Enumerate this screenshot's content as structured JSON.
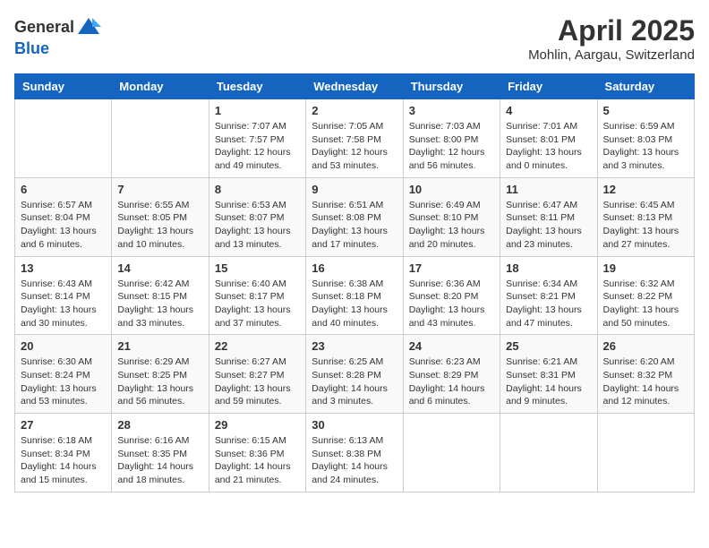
{
  "header": {
    "logo_general": "General",
    "logo_blue": "Blue",
    "month": "April 2025",
    "location": "Mohlin, Aargau, Switzerland"
  },
  "columns": [
    "Sunday",
    "Monday",
    "Tuesday",
    "Wednesday",
    "Thursday",
    "Friday",
    "Saturday"
  ],
  "weeks": [
    [
      {
        "day": "",
        "info": ""
      },
      {
        "day": "",
        "info": ""
      },
      {
        "day": "1",
        "info": "Sunrise: 7:07 AM\nSunset: 7:57 PM\nDaylight: 12 hours and 49 minutes."
      },
      {
        "day": "2",
        "info": "Sunrise: 7:05 AM\nSunset: 7:58 PM\nDaylight: 12 hours and 53 minutes."
      },
      {
        "day": "3",
        "info": "Sunrise: 7:03 AM\nSunset: 8:00 PM\nDaylight: 12 hours and 56 minutes."
      },
      {
        "day": "4",
        "info": "Sunrise: 7:01 AM\nSunset: 8:01 PM\nDaylight: 13 hours and 0 minutes."
      },
      {
        "day": "5",
        "info": "Sunrise: 6:59 AM\nSunset: 8:03 PM\nDaylight: 13 hours and 3 minutes."
      }
    ],
    [
      {
        "day": "6",
        "info": "Sunrise: 6:57 AM\nSunset: 8:04 PM\nDaylight: 13 hours and 6 minutes."
      },
      {
        "day": "7",
        "info": "Sunrise: 6:55 AM\nSunset: 8:05 PM\nDaylight: 13 hours and 10 minutes."
      },
      {
        "day": "8",
        "info": "Sunrise: 6:53 AM\nSunset: 8:07 PM\nDaylight: 13 hours and 13 minutes."
      },
      {
        "day": "9",
        "info": "Sunrise: 6:51 AM\nSunset: 8:08 PM\nDaylight: 13 hours and 17 minutes."
      },
      {
        "day": "10",
        "info": "Sunrise: 6:49 AM\nSunset: 8:10 PM\nDaylight: 13 hours and 20 minutes."
      },
      {
        "day": "11",
        "info": "Sunrise: 6:47 AM\nSunset: 8:11 PM\nDaylight: 13 hours and 23 minutes."
      },
      {
        "day": "12",
        "info": "Sunrise: 6:45 AM\nSunset: 8:13 PM\nDaylight: 13 hours and 27 minutes."
      }
    ],
    [
      {
        "day": "13",
        "info": "Sunrise: 6:43 AM\nSunset: 8:14 PM\nDaylight: 13 hours and 30 minutes."
      },
      {
        "day": "14",
        "info": "Sunrise: 6:42 AM\nSunset: 8:15 PM\nDaylight: 13 hours and 33 minutes."
      },
      {
        "day": "15",
        "info": "Sunrise: 6:40 AM\nSunset: 8:17 PM\nDaylight: 13 hours and 37 minutes."
      },
      {
        "day": "16",
        "info": "Sunrise: 6:38 AM\nSunset: 8:18 PM\nDaylight: 13 hours and 40 minutes."
      },
      {
        "day": "17",
        "info": "Sunrise: 6:36 AM\nSunset: 8:20 PM\nDaylight: 13 hours and 43 minutes."
      },
      {
        "day": "18",
        "info": "Sunrise: 6:34 AM\nSunset: 8:21 PM\nDaylight: 13 hours and 47 minutes."
      },
      {
        "day": "19",
        "info": "Sunrise: 6:32 AM\nSunset: 8:22 PM\nDaylight: 13 hours and 50 minutes."
      }
    ],
    [
      {
        "day": "20",
        "info": "Sunrise: 6:30 AM\nSunset: 8:24 PM\nDaylight: 13 hours and 53 minutes."
      },
      {
        "day": "21",
        "info": "Sunrise: 6:29 AM\nSunset: 8:25 PM\nDaylight: 13 hours and 56 minutes."
      },
      {
        "day": "22",
        "info": "Sunrise: 6:27 AM\nSunset: 8:27 PM\nDaylight: 13 hours and 59 minutes."
      },
      {
        "day": "23",
        "info": "Sunrise: 6:25 AM\nSunset: 8:28 PM\nDaylight: 14 hours and 3 minutes."
      },
      {
        "day": "24",
        "info": "Sunrise: 6:23 AM\nSunset: 8:29 PM\nDaylight: 14 hours and 6 minutes."
      },
      {
        "day": "25",
        "info": "Sunrise: 6:21 AM\nSunset: 8:31 PM\nDaylight: 14 hours and 9 minutes."
      },
      {
        "day": "26",
        "info": "Sunrise: 6:20 AM\nSunset: 8:32 PM\nDaylight: 14 hours and 12 minutes."
      }
    ],
    [
      {
        "day": "27",
        "info": "Sunrise: 6:18 AM\nSunset: 8:34 PM\nDaylight: 14 hours and 15 minutes."
      },
      {
        "day": "28",
        "info": "Sunrise: 6:16 AM\nSunset: 8:35 PM\nDaylight: 14 hours and 18 minutes."
      },
      {
        "day": "29",
        "info": "Sunrise: 6:15 AM\nSunset: 8:36 PM\nDaylight: 14 hours and 21 minutes."
      },
      {
        "day": "30",
        "info": "Sunrise: 6:13 AM\nSunset: 8:38 PM\nDaylight: 14 hours and 24 minutes."
      },
      {
        "day": "",
        "info": ""
      },
      {
        "day": "",
        "info": ""
      },
      {
        "day": "",
        "info": ""
      }
    ]
  ]
}
